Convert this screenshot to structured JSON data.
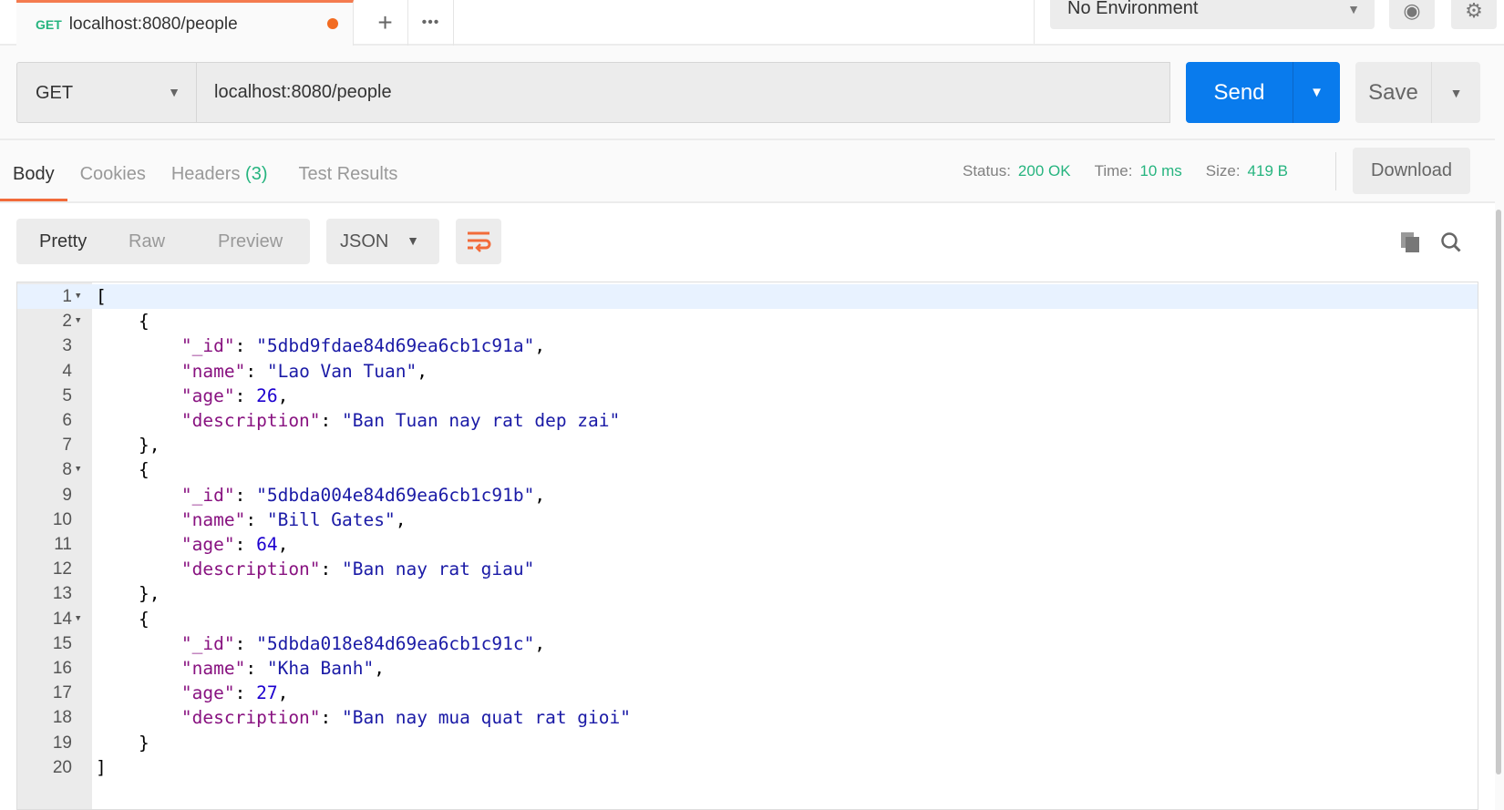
{
  "tab": {
    "method": "GET",
    "url": "localhost:8080/people",
    "add": "+",
    "more": "•••"
  },
  "environment": {
    "selected": "No Environment"
  },
  "request": {
    "method": "GET",
    "url": "localhost:8080/people",
    "send": "Send",
    "save": "Save"
  },
  "response": {
    "tabs": [
      {
        "label": "Body"
      },
      {
        "label": "Cookies"
      },
      {
        "label": "Headers",
        "count": "(3)"
      },
      {
        "label": "Test Results"
      }
    ],
    "status_label": "Status:",
    "status": "200 OK",
    "time_label": "Time:",
    "time": "10 ms",
    "size_label": "Size:",
    "size": "419 B",
    "download": "Download",
    "formats": [
      "Pretty",
      "Raw",
      "Preview"
    ],
    "language": "JSON"
  },
  "colors": {
    "accent": "#f26b3a",
    "send": "#097bed",
    "ok": "#26b47f"
  },
  "body_lines": [
    "[",
    "    {",
    "        \"_id\": \"5dbd9fdae84d69ea6cb1c91a\",",
    "        \"name\": \"Lao Van Tuan\",",
    "        \"age\": 26,",
    "        \"description\": \"Ban Tuan nay rat dep zai\"",
    "    },",
    "    {",
    "        \"_id\": \"5dbda004e84d69ea6cb1c91b\",",
    "        \"name\": \"Bill Gates\",",
    "        \"age\": 64,",
    "        \"description\": \"Ban nay rat giau\"",
    "    },",
    "    {",
    "        \"_id\": \"5dbda018e84d69ea6cb1c91c\",",
    "        \"name\": \"Kha Banh\",",
    "        \"age\": 27,",
    "        \"description\": \"Ban nay mua quat rat gioi\"",
    "    }",
    "]"
  ]
}
